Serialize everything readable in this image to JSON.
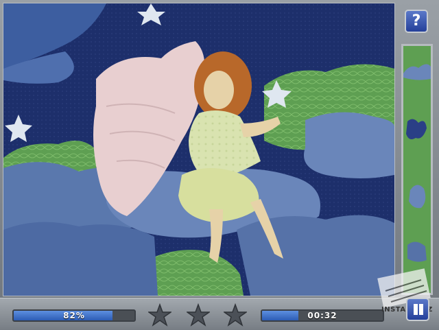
{
  "hud": {
    "progress_text": "82%",
    "progress_value": 0.82,
    "timer_text": "00:32",
    "timer_value": 0.3,
    "stars_total": 3,
    "stars_earned": 0
  },
  "buttons": {
    "help_label": "?"
  },
  "watermark": {
    "text": "INSTALUJ.CZ"
  },
  "colors": {
    "sky": "#1d2f6b",
    "cloud": "#5a78ad",
    "hills": "#5e9f52",
    "moon": "#e7eef2",
    "accent_button": "#25409a"
  }
}
